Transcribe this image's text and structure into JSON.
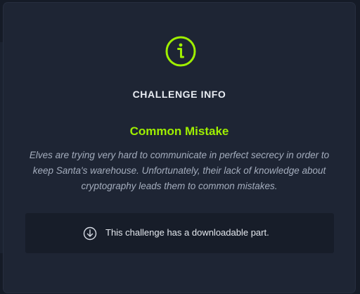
{
  "colors": {
    "accent": "#9fef00",
    "modal_background": "#1e2534",
    "download_box_background": "#171d29",
    "text_primary": "#e9edf3",
    "text_secondary": "#a4adbd"
  },
  "modal": {
    "icon": "info-icon",
    "title": "CHALLENGE INFO",
    "challenge_name": "Common Mistake",
    "description": "Elves are trying very hard to communicate in perfect secrecy in order to keep Santa's warehouse. Unfortunately, their lack of knowledge about cryptography leads them to common mistakes.",
    "download": {
      "icon": "download-icon",
      "label": "This challenge has a downloadable part."
    }
  }
}
